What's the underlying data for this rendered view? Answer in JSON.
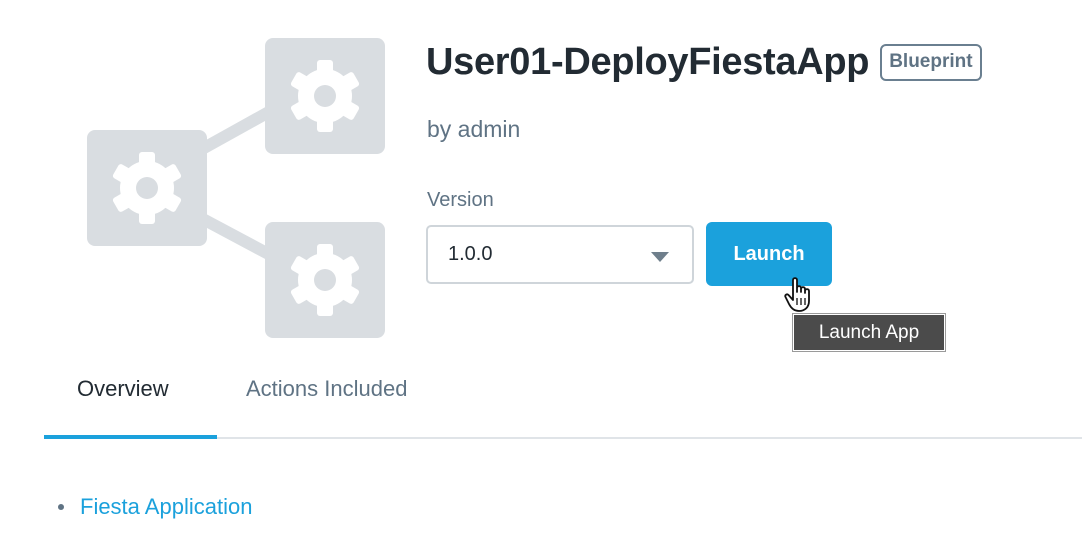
{
  "blueprint": {
    "title": "User01-DeployFiestaApp",
    "badge": "Blueprint",
    "author": "by admin",
    "graphic_icon": "gear-icon"
  },
  "version": {
    "label": "Version",
    "selected": "1.0.0"
  },
  "actions": {
    "launch_label": "Launch",
    "tooltip": "Launch App"
  },
  "tabs": [
    {
      "label": "Overview",
      "active": true
    },
    {
      "label": "Actions Included",
      "active": false
    }
  ],
  "overview": {
    "items": [
      {
        "label": "Fiesta Application"
      }
    ]
  },
  "colors": {
    "accent": "#1ba1dc",
    "tile": "#d9dde1",
    "muted_text": "#5f7384",
    "tooltip_bg": "#4b4b4b"
  }
}
